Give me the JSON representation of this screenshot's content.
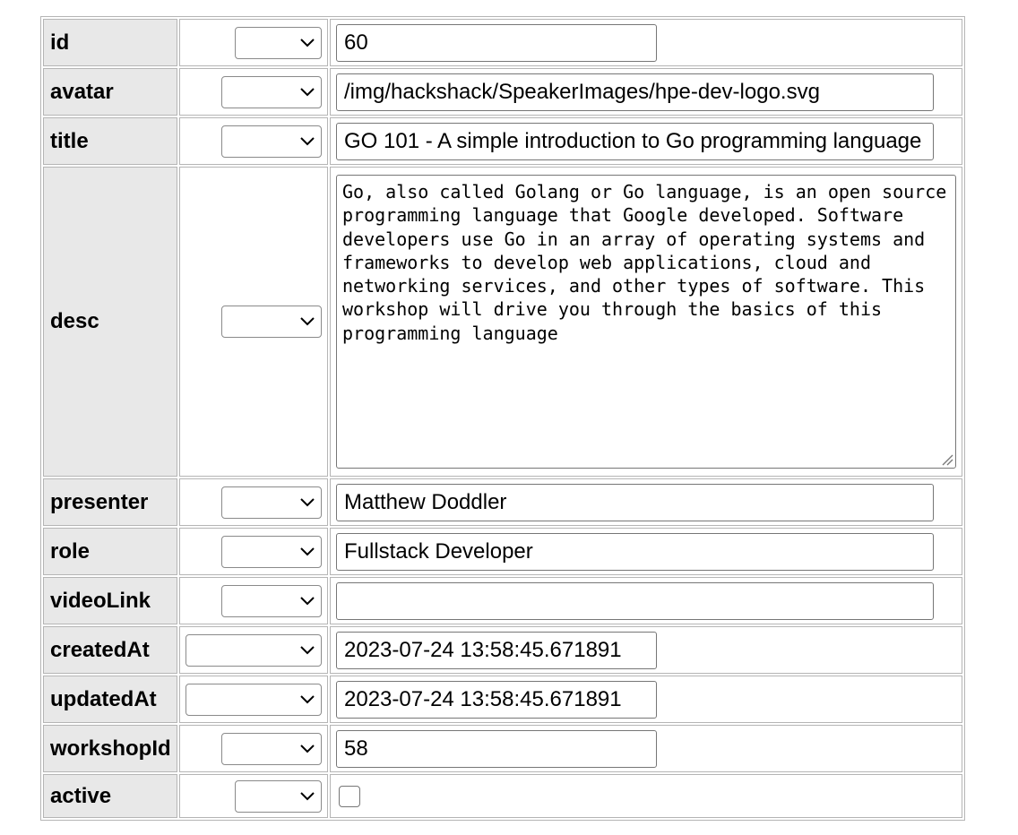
{
  "fields": [
    {
      "name": "id",
      "value": "60",
      "kind": "short"
    },
    {
      "name": "avatar",
      "value": "/img/hackshack/SpeakerImages/hpe-dev-logo.svg",
      "kind": "long"
    },
    {
      "name": "title",
      "value": "GO 101 - A simple introduction to Go programming language",
      "kind": "long"
    },
    {
      "name": "desc",
      "value": "Go, also called Golang or Go language, is an open source programming language that Google developed. Software developers use Go in an array of operating systems and frameworks to develop web applications, cloud and networking services, and other types of software. This workshop will drive you through the basics of this programming language",
      "kind": "textarea"
    },
    {
      "name": "presenter",
      "value": "Matthew Doddler",
      "kind": "long"
    },
    {
      "name": "role",
      "value": "Fullstack Developer",
      "kind": "long"
    },
    {
      "name": "videoLink",
      "value": "",
      "kind": "long"
    },
    {
      "name": "createdAt",
      "value": "2023-07-24 13:58:45.671891",
      "kind": "short"
    },
    {
      "name": "updatedAt",
      "value": "2023-07-24 13:58:45.671891",
      "kind": "short"
    },
    {
      "name": "workshopId",
      "value": "58",
      "kind": "short"
    },
    {
      "name": "active",
      "value": "",
      "kind": "checkbox"
    }
  ],
  "operator_select_value": "",
  "active_checked": false,
  "icons": {
    "select_arrow": "chevron-down-icon",
    "textarea_resize": "resize-grip-icon"
  },
  "colors": {
    "label_bg": "#e8e8e8",
    "border": "#b5b5b5"
  }
}
